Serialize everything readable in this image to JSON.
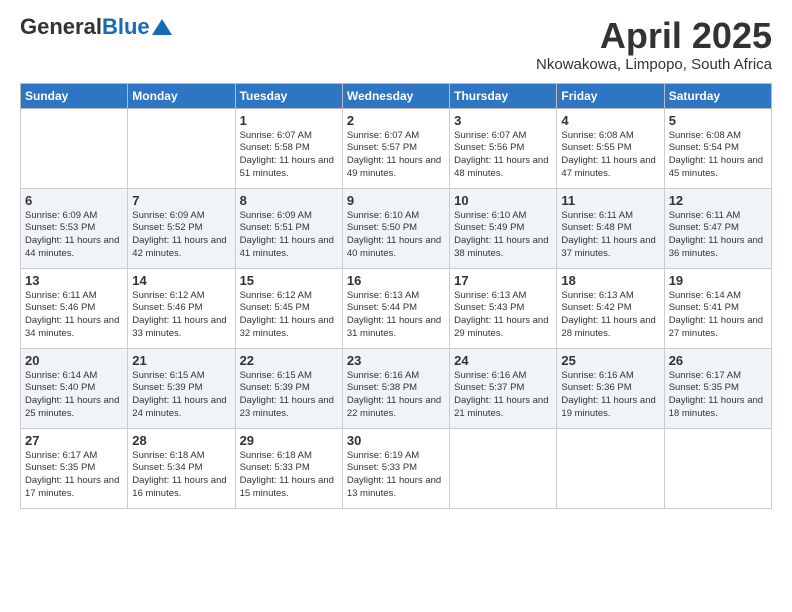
{
  "header": {
    "logo_general": "General",
    "logo_blue": "Blue",
    "month_title": "April 2025",
    "location": "Nkowakowa, Limpopo, South Africa"
  },
  "days_of_week": [
    "Sunday",
    "Monday",
    "Tuesday",
    "Wednesday",
    "Thursday",
    "Friday",
    "Saturday"
  ],
  "weeks": [
    [
      {
        "day": "",
        "text": ""
      },
      {
        "day": "",
        "text": ""
      },
      {
        "day": "1",
        "text": "Sunrise: 6:07 AM\nSunset: 5:58 PM\nDaylight: 11 hours and 51 minutes."
      },
      {
        "day": "2",
        "text": "Sunrise: 6:07 AM\nSunset: 5:57 PM\nDaylight: 11 hours and 49 minutes."
      },
      {
        "day": "3",
        "text": "Sunrise: 6:07 AM\nSunset: 5:56 PM\nDaylight: 11 hours and 48 minutes."
      },
      {
        "day": "4",
        "text": "Sunrise: 6:08 AM\nSunset: 5:55 PM\nDaylight: 11 hours and 47 minutes."
      },
      {
        "day": "5",
        "text": "Sunrise: 6:08 AM\nSunset: 5:54 PM\nDaylight: 11 hours and 45 minutes."
      }
    ],
    [
      {
        "day": "6",
        "text": "Sunrise: 6:09 AM\nSunset: 5:53 PM\nDaylight: 11 hours and 44 minutes."
      },
      {
        "day": "7",
        "text": "Sunrise: 6:09 AM\nSunset: 5:52 PM\nDaylight: 11 hours and 42 minutes."
      },
      {
        "day": "8",
        "text": "Sunrise: 6:09 AM\nSunset: 5:51 PM\nDaylight: 11 hours and 41 minutes."
      },
      {
        "day": "9",
        "text": "Sunrise: 6:10 AM\nSunset: 5:50 PM\nDaylight: 11 hours and 40 minutes."
      },
      {
        "day": "10",
        "text": "Sunrise: 6:10 AM\nSunset: 5:49 PM\nDaylight: 11 hours and 38 minutes."
      },
      {
        "day": "11",
        "text": "Sunrise: 6:11 AM\nSunset: 5:48 PM\nDaylight: 11 hours and 37 minutes."
      },
      {
        "day": "12",
        "text": "Sunrise: 6:11 AM\nSunset: 5:47 PM\nDaylight: 11 hours and 36 minutes."
      }
    ],
    [
      {
        "day": "13",
        "text": "Sunrise: 6:11 AM\nSunset: 5:46 PM\nDaylight: 11 hours and 34 minutes."
      },
      {
        "day": "14",
        "text": "Sunrise: 6:12 AM\nSunset: 5:46 PM\nDaylight: 11 hours and 33 minutes."
      },
      {
        "day": "15",
        "text": "Sunrise: 6:12 AM\nSunset: 5:45 PM\nDaylight: 11 hours and 32 minutes."
      },
      {
        "day": "16",
        "text": "Sunrise: 6:13 AM\nSunset: 5:44 PM\nDaylight: 11 hours and 31 minutes."
      },
      {
        "day": "17",
        "text": "Sunrise: 6:13 AM\nSunset: 5:43 PM\nDaylight: 11 hours and 29 minutes."
      },
      {
        "day": "18",
        "text": "Sunrise: 6:13 AM\nSunset: 5:42 PM\nDaylight: 11 hours and 28 minutes."
      },
      {
        "day": "19",
        "text": "Sunrise: 6:14 AM\nSunset: 5:41 PM\nDaylight: 11 hours and 27 minutes."
      }
    ],
    [
      {
        "day": "20",
        "text": "Sunrise: 6:14 AM\nSunset: 5:40 PM\nDaylight: 11 hours and 25 minutes."
      },
      {
        "day": "21",
        "text": "Sunrise: 6:15 AM\nSunset: 5:39 PM\nDaylight: 11 hours and 24 minutes."
      },
      {
        "day": "22",
        "text": "Sunrise: 6:15 AM\nSunset: 5:39 PM\nDaylight: 11 hours and 23 minutes."
      },
      {
        "day": "23",
        "text": "Sunrise: 6:16 AM\nSunset: 5:38 PM\nDaylight: 11 hours and 22 minutes."
      },
      {
        "day": "24",
        "text": "Sunrise: 6:16 AM\nSunset: 5:37 PM\nDaylight: 11 hours and 21 minutes."
      },
      {
        "day": "25",
        "text": "Sunrise: 6:16 AM\nSunset: 5:36 PM\nDaylight: 11 hours and 19 minutes."
      },
      {
        "day": "26",
        "text": "Sunrise: 6:17 AM\nSunset: 5:35 PM\nDaylight: 11 hours and 18 minutes."
      }
    ],
    [
      {
        "day": "27",
        "text": "Sunrise: 6:17 AM\nSunset: 5:35 PM\nDaylight: 11 hours and 17 minutes."
      },
      {
        "day": "28",
        "text": "Sunrise: 6:18 AM\nSunset: 5:34 PM\nDaylight: 11 hours and 16 minutes."
      },
      {
        "day": "29",
        "text": "Sunrise: 6:18 AM\nSunset: 5:33 PM\nDaylight: 11 hours and 15 minutes."
      },
      {
        "day": "30",
        "text": "Sunrise: 6:19 AM\nSunset: 5:33 PM\nDaylight: 11 hours and 13 minutes."
      },
      {
        "day": "",
        "text": ""
      },
      {
        "day": "",
        "text": ""
      },
      {
        "day": "",
        "text": ""
      }
    ]
  ]
}
